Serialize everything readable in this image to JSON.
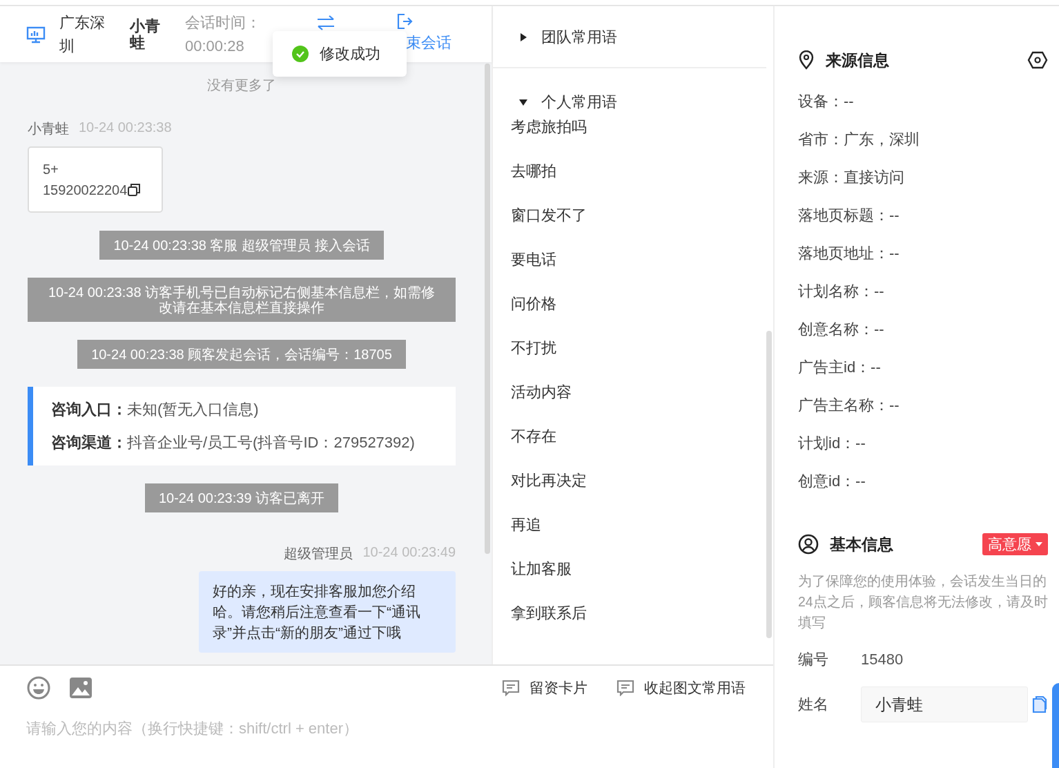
{
  "header": {
    "location": "广东深圳",
    "visitor": "小青蛙",
    "timer_label": "会话时间：",
    "timer": "00:00:28",
    "end_label": "束会话"
  },
  "toast": {
    "text": "修改成功"
  },
  "chat": {
    "no_more": "没有更多了",
    "messages": [
      {
        "kind": "card",
        "sender": "小青蛙",
        "time": "10-24 00:23:38",
        "lines": [
          "5+",
          "15920022204"
        ]
      },
      {
        "kind": "system",
        "text": "10-24 00:23:38 客服 超级管理员 接入会话"
      },
      {
        "kind": "system",
        "text": "10-24 00:23:38 访客手机号已自动标记右侧基本信息栏，如需修改请在基本信息栏直接操作"
      },
      {
        "kind": "system",
        "text": "10-24 00:23:38 顾客发起会话，会话编号：18705"
      },
      {
        "kind": "info",
        "rows": [
          {
            "label": "咨询入口：",
            "value": "未知(暂无入口信息)"
          },
          {
            "label": "咨询渠道：",
            "value": "抖音企业号/员工号(抖音号ID：279527392)"
          }
        ]
      },
      {
        "kind": "system",
        "text": "10-24 00:23:39 访客已离开"
      },
      {
        "kind": "agent",
        "sender": "超级管理员",
        "time": "10-24 00:23:49",
        "text": "好的亲，现在安排客服加您介绍哈。请您稍后注意查看一下“通讯录”并点击“新的朋友”通过下哦"
      }
    ]
  },
  "phrases": [
    {
      "title": "团队常用语",
      "expanded": false
    },
    {
      "title": "个人常用语",
      "expanded": true,
      "items": [
        "考虑旅拍吗",
        "去哪拍",
        "窗口发不了",
        "要电话",
        "问价格",
        "不打扰",
        "活动内容",
        "不存在",
        "对比再决定",
        "再追",
        "让加客服",
        "拿到联系后"
      ]
    }
  ],
  "composer": {
    "tools": [
      "留资卡片",
      "收起图文常用语"
    ],
    "placeholder": "请输入您的内容（换行快捷键：shift/ctrl + enter）"
  },
  "source": {
    "title": "来源信息",
    "fields": [
      "设备：--",
      "省市：广东，深圳",
      "来源：直接访问",
      "落地页标题：--",
      "落地页地址：--",
      "计划名称：--",
      "创意名称：--",
      "广告主id：--",
      "广告主名称：--",
      "计划id：--",
      "创意id：--"
    ]
  },
  "basic": {
    "title": "基本信息",
    "tag": "高意愿",
    "note": "为了保障您的使用体验，会话发生当日的24点之后，顾客信息将无法修改，请及时填写",
    "fields": [
      {
        "kind": "text",
        "label": "编号",
        "value": "15480"
      },
      {
        "kind": "input",
        "label": "姓名",
        "value": "小青蛙"
      }
    ]
  }
}
